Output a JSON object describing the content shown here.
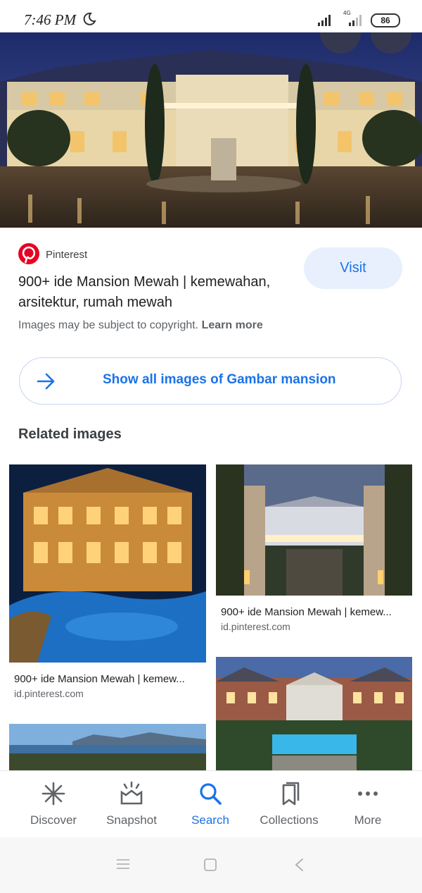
{
  "status_bar": {
    "time": "7:46 PM",
    "network": "4G",
    "battery": "86"
  },
  "result": {
    "source": "Pinterest",
    "title": "900+ ide Mansion Mewah | kemewahan, arsitektur, rumah mewah",
    "visit_label": "Visit",
    "copyright_text": "Images may be subject to copyright.",
    "learn_more_label": "Learn more"
  },
  "show_all_label": "Show all images of Gambar mansion",
  "related": {
    "heading": "Related images",
    "items": [
      {
        "caption": "900+ ide Mansion Mewah | kemew...",
        "domain": "id.pinterest.com"
      },
      {
        "caption": "900+ ide Mansion Mewah | kemew...",
        "domain": "id.pinterest.com"
      }
    ]
  },
  "bottom_nav": {
    "items": [
      {
        "label": "Discover",
        "icon": "asterisk-icon"
      },
      {
        "label": "Snapshot",
        "icon": "snapshot-icon"
      },
      {
        "label": "Search",
        "icon": "search-icon",
        "active": true
      },
      {
        "label": "Collections",
        "icon": "collections-icon"
      },
      {
        "label": "More",
        "icon": "more-dots-icon"
      }
    ]
  },
  "colors": {
    "accent": "#1a73e8",
    "pinterest": "#e60023",
    "visit_bg": "#e8f0fe"
  }
}
